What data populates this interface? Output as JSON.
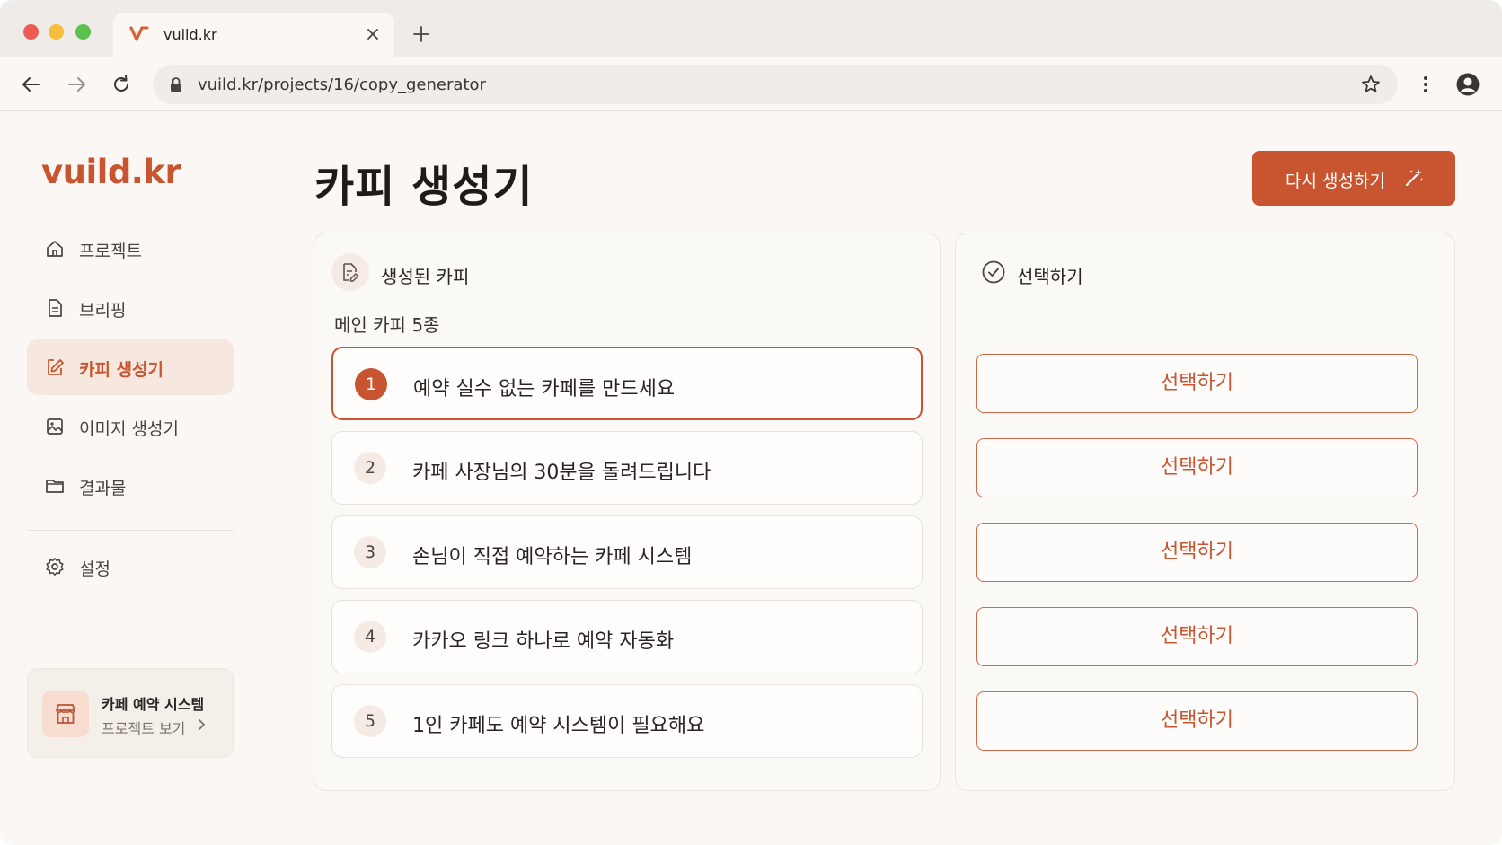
{
  "browser": {
    "tab_title": "vuild.kr",
    "url": "vuild.kr/projects/16/copy_generator"
  },
  "sidebar": {
    "brand": "vuild.kr",
    "items": [
      {
        "label": "프로젝트",
        "icon": "home-icon"
      },
      {
        "label": "브리핑",
        "icon": "document-icon"
      },
      {
        "label": "카피 생성기",
        "icon": "edit-icon",
        "active": true
      },
      {
        "label": "이미지 생성기",
        "icon": "image-icon"
      },
      {
        "label": "결과물",
        "icon": "folder-icon"
      }
    ],
    "settings": {
      "label": "설정",
      "icon": "gear-icon"
    },
    "project_card": {
      "title": "카페 예약 시스템",
      "link": "프로젝트 보기",
      "icon": "store-icon"
    }
  },
  "main": {
    "title": "카피 생성기",
    "regenerate_label": "다시 생성하기",
    "left_panel": {
      "title": "생성된 카피",
      "section_label": "메인 카피 5종",
      "copies": [
        {
          "num": "1",
          "text": "예약 실수 없는 카페를 만드세요",
          "selected": true
        },
        {
          "num": "2",
          "text": "카페 사장님의 30분을 돌려드립니다"
        },
        {
          "num": "3",
          "text": "손님이 직접 예약하는 카페 시스템"
        },
        {
          "num": "4",
          "text": "카카오 링크 하나로 예약 자동화"
        },
        {
          "num": "5",
          "text": "1인 카페도 예약 시스템이 필요해요"
        }
      ]
    },
    "right_panel": {
      "title": "선택하기",
      "buttons": [
        "선택하기",
        "선택하기",
        "선택하기",
        "선택하기",
        "선택하기"
      ]
    }
  },
  "colors": {
    "accent": "#c8552f",
    "background": "#faf7f4"
  }
}
